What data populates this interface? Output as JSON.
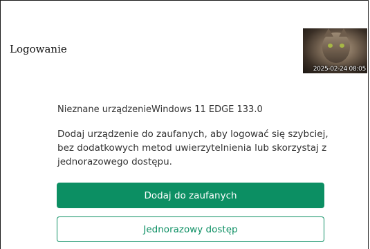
{
  "header": {
    "title": "Logowanie"
  },
  "avatar": {
    "timestamp": "2025-02-24 08:05"
  },
  "device": {
    "text": "Nieznane urządzenieWindows 11 EDGE 133.0"
  },
  "description": {
    "text": "Dodaj urządzenie do zaufanych, aby logować się szybciej, bez dodatkowych metod uwierzytelnienia lub skorzystaj z jednorazowego dostępu."
  },
  "actions": {
    "trust_label": "Dodaj do zaufanych",
    "one_time_label": "Jednorazowy dostęp"
  },
  "colors": {
    "accent": "#0c8f63",
    "text": "#333333",
    "background": "#ffffff"
  }
}
